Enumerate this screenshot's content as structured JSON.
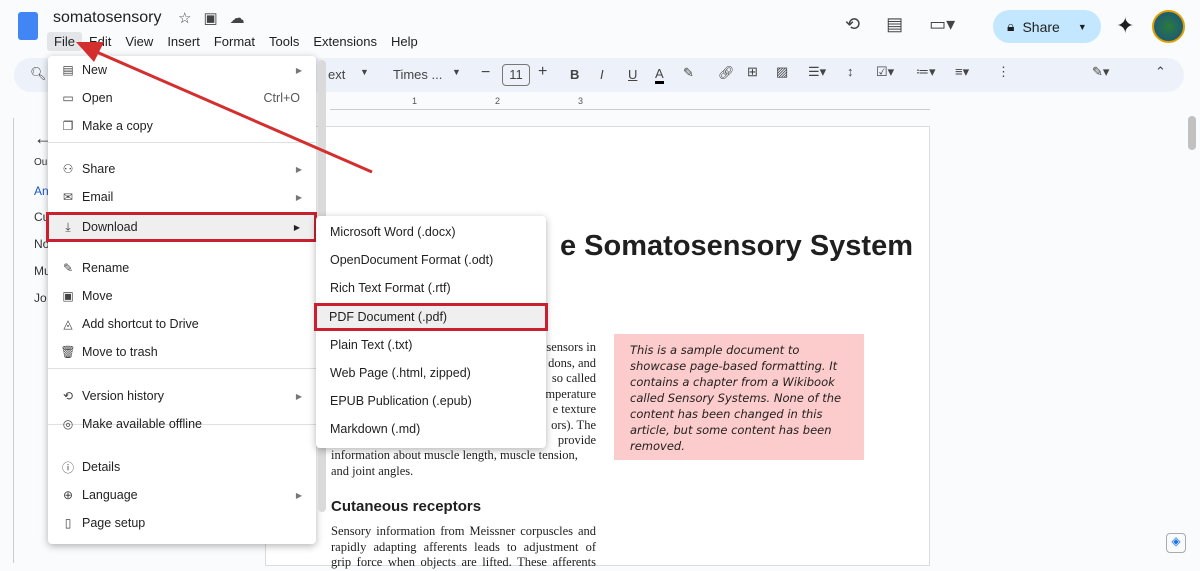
{
  "header": {
    "title": "somatosensory",
    "share_label": "Share"
  },
  "menubar": [
    "File",
    "Edit",
    "View",
    "Insert",
    "Format",
    "Tools",
    "Extensions",
    "Help"
  ],
  "toolbar": {
    "style": "ext",
    "font": "Times ...",
    "size": "11"
  },
  "ruler": [
    "1",
    "2",
    "3"
  ],
  "outline": {
    "title": "Ou",
    "items": [
      "An",
      "Cu",
      "No",
      "Mu",
      "Jo"
    ]
  },
  "file_menu": [
    {
      "label": "New",
      "icon": "new-doc-icon",
      "submenu": true
    },
    {
      "label": "Open",
      "icon": "folder-icon",
      "shortcut": "Ctrl+O"
    },
    {
      "label": "Make a copy",
      "icon": "copy-icon"
    },
    {
      "label": "Share",
      "icon": "person-add-icon",
      "submenu": true
    },
    {
      "label": "Email",
      "icon": "email-icon",
      "submenu": true
    },
    {
      "label": "Download",
      "icon": "download-icon",
      "submenu": true
    },
    {
      "label": "Rename",
      "icon": "rename-icon"
    },
    {
      "label": "Move",
      "icon": "move-folder-icon"
    },
    {
      "label": "Add shortcut to Drive",
      "icon": "drive-shortcut-icon"
    },
    {
      "label": "Move to trash",
      "icon": "trash-icon"
    },
    {
      "label": "Version history",
      "icon": "history-icon",
      "submenu": true
    },
    {
      "label": "Make available offline",
      "icon": "offline-icon"
    },
    {
      "label": "Details",
      "icon": "info-icon"
    },
    {
      "label": "Language",
      "icon": "globe-icon",
      "submenu": true
    },
    {
      "label": "Page setup",
      "icon": "page-icon"
    }
  ],
  "download_menu": [
    "Microsoft Word (.docx)",
    "OpenDocument Format (.odt)",
    "Rich Text Format (.rtf)",
    "PDF Document (.pdf)",
    "Plain Text (.txt)",
    "Web Page (.html, zipped)",
    "EPUB Publication (.epub)",
    "Markdown (.md)"
  ],
  "document": {
    "heading": "e Somatosensory System",
    "para_fragments": [
      "sensors in",
      "dons, and",
      "so called",
      "mperature",
      "e texture",
      "ors). The",
      "provide"
    ],
    "para_full": [
      "information about muscle length, muscle tension,",
      "and joint angles."
    ],
    "subheading": "Cutaneous receptors",
    "para2": [
      "Sensory information from Meissner corpuscles and",
      "rapidly adapting afferents leads to adjustment of",
      "grip force when objects are lifted. These afferents"
    ],
    "note": "This is a sample document to showcase page-based formatting. It contains a chapter from a Wikibook called Sensory Systems. None of the content has been changed in this article, but some content has been removed."
  },
  "colors": {
    "highlight": "#c8202f",
    "arrow": "#d32f2f",
    "share_bg": "#c2e7ff",
    "note_bg": "#fccbcb"
  }
}
